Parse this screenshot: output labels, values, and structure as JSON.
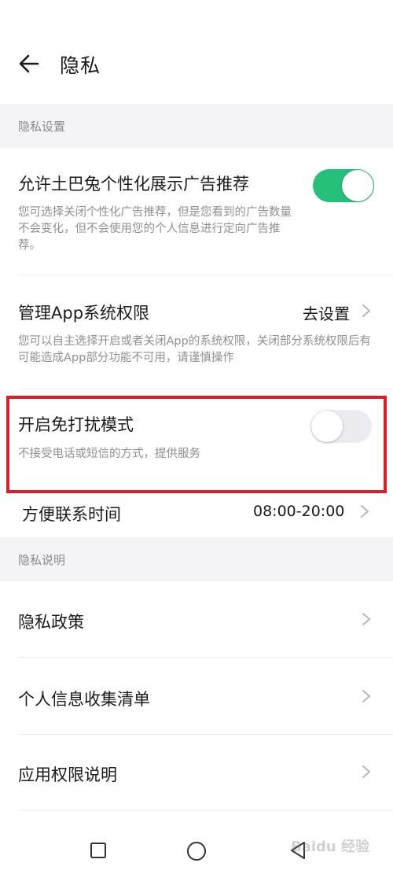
{
  "header": {
    "title": "隐私"
  },
  "sections": {
    "privacy_settings": {
      "label": "隐私设置"
    },
    "privacy_info": {
      "label": "隐私说明"
    }
  },
  "settings": {
    "ads": {
      "title": "允许土巴兔个性化展示广告推荐",
      "desc": "您可选择关闭个性化广告推荐，但是您看到的广告数量不会变化，但不会使用您的个人信息进行定向广告推荐。",
      "enabled": true
    },
    "permissions": {
      "title": "管理App系统权限",
      "action": "去设置",
      "desc": "您可以自主选择开启或者关闭App的系统权限，关闭部分系统权限后有可能造成App部分功能不可用，请谨慎操作"
    },
    "dnd": {
      "title": "开启免打扰模式",
      "desc": "不接受电话或短信的方式，提供服务",
      "enabled": false
    },
    "contact_time": {
      "title": "方便联系时间",
      "value": "08:00-20:00"
    }
  },
  "info_items": [
    {
      "label": "隐私政策"
    },
    {
      "label": "个人信息收集清单"
    },
    {
      "label": "应用权限说明"
    }
  ],
  "colors": {
    "toggle_on": "#27c07a",
    "highlight": "#d4202b"
  },
  "watermark": "Baidu 经验"
}
